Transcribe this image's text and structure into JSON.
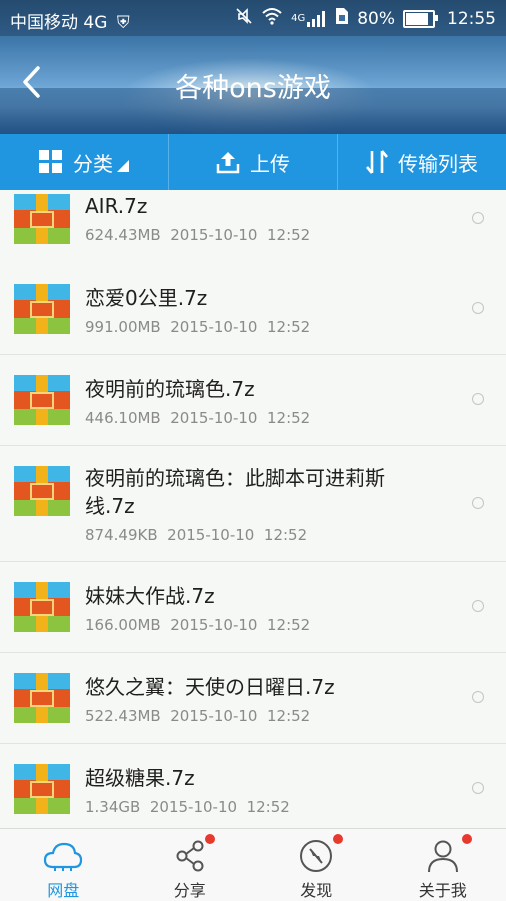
{
  "status": {
    "carrier": "中国移动 4G",
    "network": "4G",
    "battery": "80%",
    "time": "12:55"
  },
  "header": {
    "title": "各种ons游戏"
  },
  "toolbar": {
    "category_label": "分类",
    "upload_label": "上传",
    "transfer_label": "传输列表"
  },
  "files": [
    {
      "name": "AIR.7z",
      "size": "624.43MB",
      "date": "2015-10-10",
      "time": "12:52"
    },
    {
      "name": "恋爱0公里.7z",
      "size": "991.00MB",
      "date": "2015-10-10",
      "time": "12:52"
    },
    {
      "name": "夜明前的琉璃色.7z",
      "size": "446.10MB",
      "date": "2015-10-10",
      "time": "12:52"
    },
    {
      "name": "夜明前的琉璃色：此脚本可进莉斯线.7z",
      "size": "874.49KB",
      "date": "2015-10-10",
      "time": "12:52"
    },
    {
      "name": "妹妹大作战.7z",
      "size": "166.00MB",
      "date": "2015-10-10",
      "time": "12:52"
    },
    {
      "name": "悠久之翼：天使の日曜日.7z",
      "size": "522.43MB",
      "date": "2015-10-10",
      "time": "12:52"
    },
    {
      "name": "超级糖果.7z",
      "size": "1.34GB",
      "date": "2015-10-10",
      "time": "12:52"
    }
  ],
  "nav": [
    {
      "label": "网盘",
      "icon": "cloud-icon",
      "active": true
    },
    {
      "label": "分享",
      "icon": "share-icon",
      "badge": true
    },
    {
      "label": "发现",
      "icon": "compass-icon",
      "badge": true
    },
    {
      "label": "关于我",
      "icon": "person-icon",
      "badge": true
    }
  ],
  "colors": {
    "accent": "#2196e0",
    "badge": "#e8392e"
  }
}
